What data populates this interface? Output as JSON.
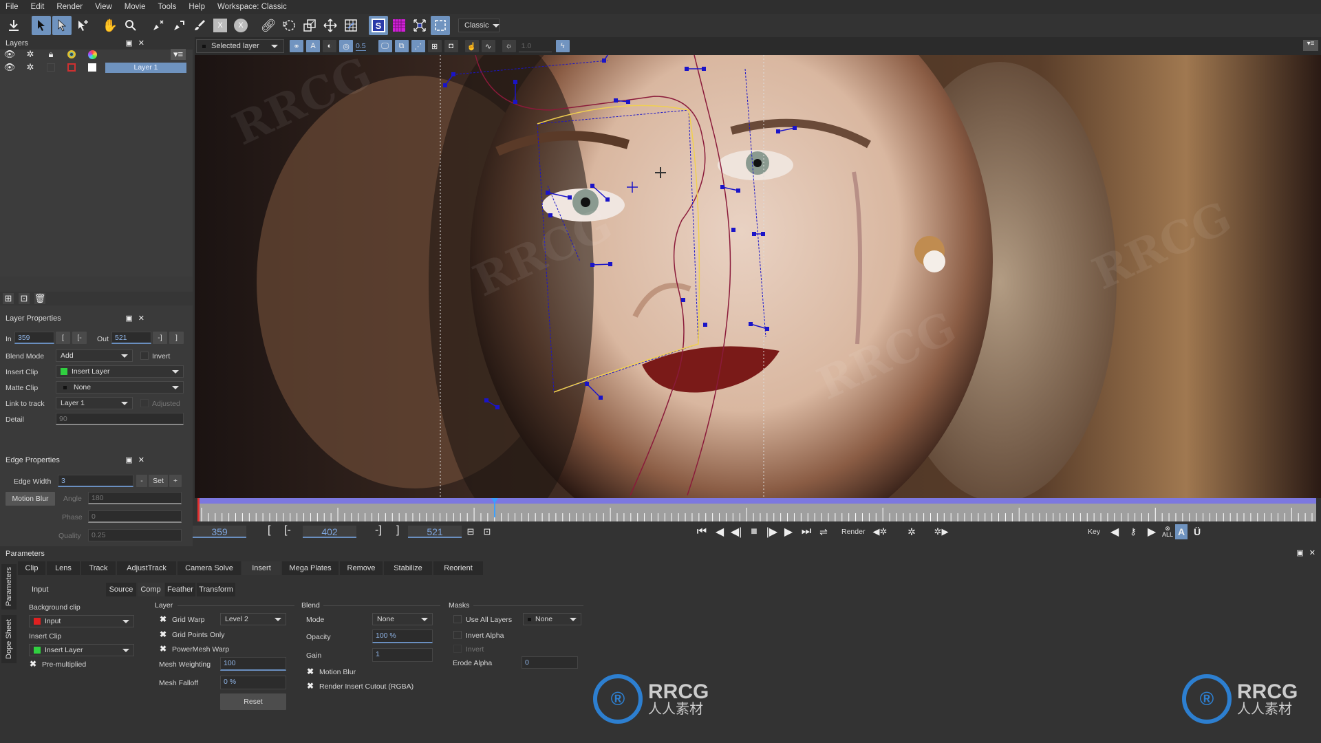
{
  "menu": [
    "File",
    "Edit",
    "Render",
    "View",
    "Movie",
    "Tools",
    "Help"
  ],
  "workspace_label": "Workspace: Classic",
  "toolbar": {
    "workspace_select": "Classic",
    "tools": [
      "export-icon",
      "select-icon",
      "select-points-icon",
      "add-point-icon",
      "hand-icon",
      "zoom-icon",
      "pen-remove-icon",
      "pen-magnet-icon",
      "brush-icon",
      "rect-clear-icon",
      "ellipse-clear-icon",
      "link-icon",
      "transform-rotate-icon",
      "scale-icon",
      "move-icon",
      "grid-warp-icon",
      "surface-icon",
      "mesh-icon",
      "expand-icon",
      "frame-icon"
    ]
  },
  "layers_panel": {
    "title": "Layers",
    "layer": {
      "name": "Layer 1"
    }
  },
  "layer_properties": {
    "title": "Layer Properties",
    "in_label": "In",
    "in_value": "359",
    "out_label": "Out",
    "out_value": "521",
    "in_btn1": "[",
    "in_btn2": "[-",
    "out_btn1": "-]",
    "out_btn2": "]",
    "blend_mode_label": "Blend Mode",
    "blend_mode_value": "Add",
    "invert_label": "Invert",
    "insert_clip_label": "Insert Clip",
    "insert_clip_value": "Insert Layer",
    "matte_clip_label": "Matte Clip",
    "matte_clip_value": "None",
    "link_track_label": "Link to track",
    "link_track_value": "Layer 1",
    "adjusted_label": "Adjusted",
    "detail_label": "Detail",
    "detail_value": "90"
  },
  "edge_properties": {
    "title": "Edge Properties",
    "edge_width_label": "Edge Width",
    "edge_width_value": "3",
    "minus": "-",
    "set": "Set",
    "plus": "+",
    "motion_blur_button": "Motion Blur",
    "angle_label": "Angle",
    "angle_value": "180",
    "phase_label": "Phase",
    "phase_value": "0",
    "quality_label": "Quality",
    "quality_value": "0.25"
  },
  "viewer_toolbar": {
    "layer_select": "Selected layer",
    "opacity_value": "0.5",
    "exposure_value": "1.0"
  },
  "timeline": {
    "start": "359",
    "current": "402",
    "end": "521",
    "bracket_in": "[",
    "bracket_in_set": "[-",
    "bracket_out_set": "-]",
    "bracket_out": "]",
    "playhead_fraction": 0.265,
    "render_label": "Render",
    "key_label": "Key",
    "key_all_label": "ALL"
  },
  "parameters": {
    "title": "Parameters",
    "side_tabs": [
      "Parameters",
      "Dope Sheet"
    ],
    "tabs": [
      "Clip",
      "Lens",
      "Track",
      "AdjustTrack",
      "Camera Solve",
      "Insert",
      "Mega Plates",
      "Remove",
      "Stabilize",
      "Reorient"
    ],
    "active_tab": "Insert",
    "input_label": "Input",
    "subtabs": [
      "Source",
      "Comp",
      "Feather",
      "Transform"
    ],
    "active_subtab": "Comp",
    "background_clip_label": "Background clip",
    "background_clip_value": "Input",
    "insert_clip_label": "Insert Clip",
    "insert_clip_value": "Insert Layer",
    "premultiplied_label": "Pre-multiplied",
    "layer_section": "Layer",
    "grid_warp_label": "Grid Warp",
    "grid_warp_value": "Level 2",
    "grid_points_only_label": "Grid Points Only",
    "powermesh_warp_label": "PowerMesh Warp",
    "mesh_weighting_label": "Mesh Weighting",
    "mesh_weighting_value": "100",
    "mesh_falloff_label": "Mesh Falloff",
    "mesh_falloff_value": "0 %",
    "reset_label": "Reset",
    "blend_section": "Blend",
    "mode_label": "Mode",
    "mode_value": "None",
    "opacity_label": "Opacity",
    "opacity_value": "100 %",
    "gain_label": "Gain",
    "gain_value": "1",
    "motion_blur_label": "Motion Blur",
    "render_insert_cutout_label": "Render Insert Cutout (RGBA)",
    "masks_section": "Masks",
    "use_all_layers_label": "Use All Layers",
    "use_all_layers_value": "None",
    "invert_alpha_label": "Invert Alpha",
    "invert_label": "Invert",
    "erode_alpha_label": "Erode Alpha",
    "erode_alpha_value": "0"
  },
  "watermark": {
    "logo_text": "RRCG",
    "logo_sub": "人人素材"
  },
  "colors": {
    "accent": "#6f93bf",
    "field_text": "#8fb4e6",
    "range_bar": "#7c78e0",
    "spline": "#8a1a3a",
    "tracker_point": "#1a14c8",
    "yellow_edge": "#f0d050",
    "input_swatch": "#e02020",
    "insert_swatch": "#30d040"
  }
}
